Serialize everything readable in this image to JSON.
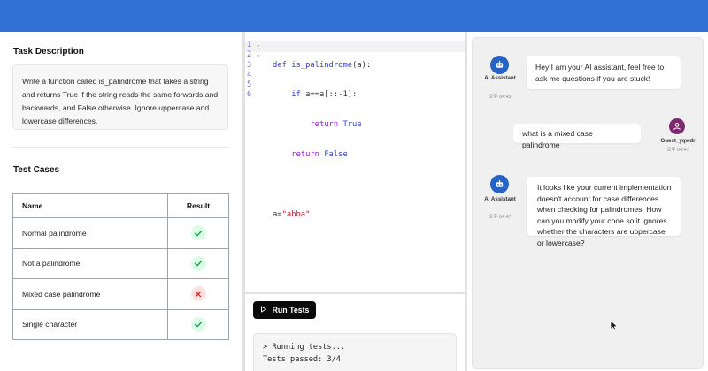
{
  "task": {
    "title": "Task Description",
    "description": "Write a function called is_palindrome that takes a string and returns True if the string reads the same forwards and backwards, and False otherwise. Ignore uppercase and lowercase differences."
  },
  "tests": {
    "title": "Test Cases",
    "columns": [
      "Name",
      "Result"
    ],
    "rows": [
      {
        "name": "Normal palindrome",
        "result": "pass",
        "icon": "check-icon"
      },
      {
        "name": "Not a palindrome",
        "result": "pass",
        "icon": "check-icon"
      },
      {
        "name": "Mixed case palindrome",
        "result": "fail",
        "icon": "cross-icon"
      },
      {
        "name": "Single character",
        "result": "pass",
        "icon": "check-icon"
      }
    ]
  },
  "editor": {
    "line_numbers": [
      "1",
      "2",
      "3",
      "4",
      "5",
      "6"
    ],
    "lines": [
      "def is_palindrome(a):",
      "    if a==a[::-1]:",
      "        return True",
      "    return False",
      "",
      "a=\"abba\""
    ]
  },
  "run": {
    "label": "Run Tests",
    "icon": "play-icon"
  },
  "console": {
    "lines": [
      "> Running tests...",
      "Tests passed: 3/4"
    ]
  },
  "chat": {
    "messages": [
      {
        "sender": "ai",
        "name": "AI Assistant",
        "time": "오후 04:45",
        "text": "Hey I am your AI assistant, feel free to ask me questions if you are stuck!"
      },
      {
        "sender": "user",
        "name": "Guest_yqwdr",
        "time": "오후 04:47",
        "text": "what is a mixed case palindrome"
      },
      {
        "sender": "ai",
        "name": "AI Assistant",
        "time": "오후 04:47",
        "text": "It looks like your current implementation doesn't account for case differences when checking for palindromes. How can you modify your code so it ignores whether the characters are uppercase or lowercase?"
      }
    ]
  },
  "colors": {
    "topbar": "#3170d4",
    "ai_avatar": "#2563c6",
    "user_avatar": "#7c2a6e",
    "pass": "#16a34a",
    "fail": "#dc2626"
  }
}
